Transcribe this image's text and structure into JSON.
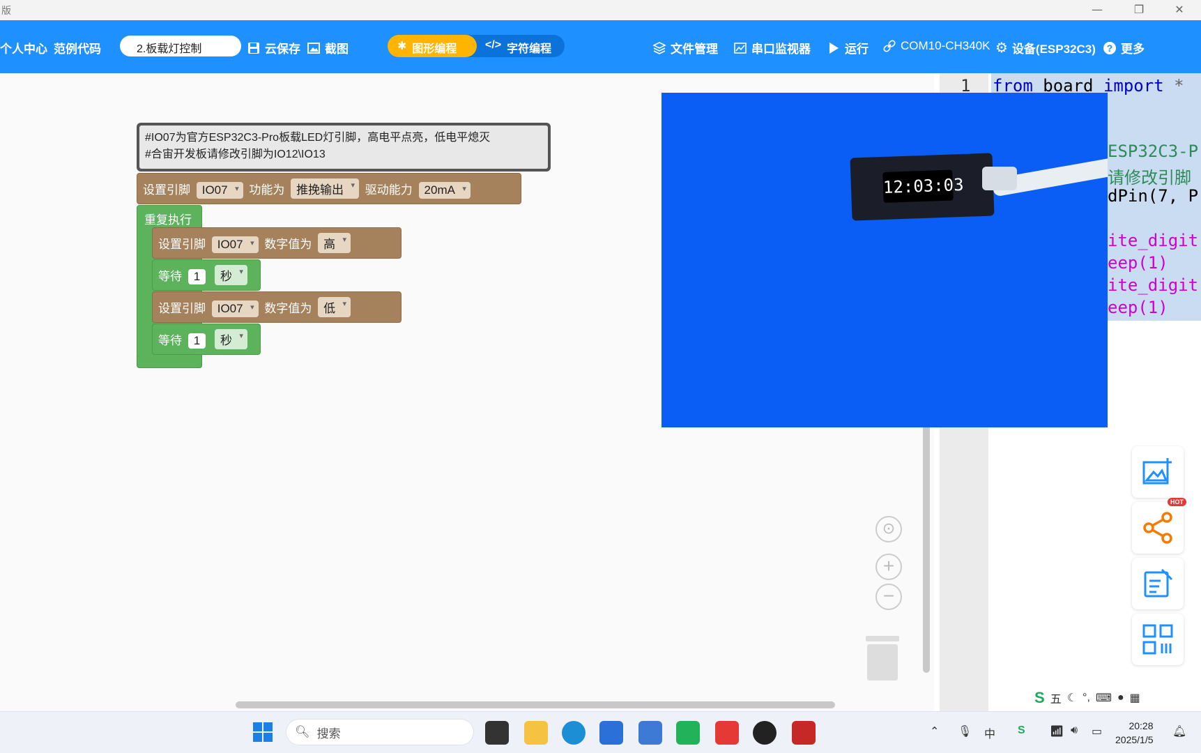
{
  "window": {
    "title": "版",
    "controls": [
      "—",
      "❐",
      "✕"
    ]
  },
  "toolbar": {
    "user_center": "个人中心",
    "examples": "范例代码",
    "file_name": "2.板载灯控制",
    "cloud_save": "云保存",
    "screenshot": "截图",
    "graphic_mode": "图形编程",
    "code_mode": "字符编程",
    "file_manager": "文件管理",
    "serial_monitor": "串口监视器",
    "run": "运行",
    "port": "COM10-CH340K",
    "device": "设备(ESP32C3)",
    "more": "更多",
    "accent_color": "#1e90ff",
    "mode_active_color": "#ffb400"
  },
  "blocks": {
    "comment_line1": "#IO07为官方ESP32C3-Pro板载LED灯引脚，高电平点亮，低电平熄灭",
    "comment_line2": "#合宙开发板请修改引脚为IO12\\IO13",
    "setup": {
      "label_set_pin": "设置引脚",
      "pin": "IO07",
      "label_function": "功能为",
      "mode": "推挽输出",
      "label_drive": "驱动能力",
      "drive": "20mA"
    },
    "loop_label": "重复执行",
    "steps": [
      {
        "label": "设置引脚",
        "pin": "IO07",
        "value_label": "数字值为",
        "value": "高"
      },
      {
        "label": "等待",
        "amount": "1",
        "unit": "秒"
      },
      {
        "label": "设置引脚",
        "pin": "IO07",
        "value_label": "数字值为",
        "value": "低"
      },
      {
        "label": "等待",
        "amount": "1",
        "unit": "秒"
      }
    ]
  },
  "video": {
    "clock_text": "12:03:03"
  },
  "editor": {
    "line_number": "1",
    "line1": {
      "kw1": "from",
      "mod": "board",
      "kw2": "import",
      "rest": "*"
    },
    "fragments": {
      "f1": "ESP32C3-P",
      "f2": "请修改引脚",
      "f3": "dPin(7, P",
      "f4": "ite_digit",
      "f5": "eep(1)",
      "f6": "ite_digit",
      "f7": "eep(1)"
    }
  },
  "side_tools": {
    "hot_badge": "HOT"
  },
  "ime": {
    "mode": "五",
    "punct": "°,"
  },
  "taskbar": {
    "search_placeholder": "搜索",
    "time": "20:28",
    "date": "2025/1/5"
  }
}
